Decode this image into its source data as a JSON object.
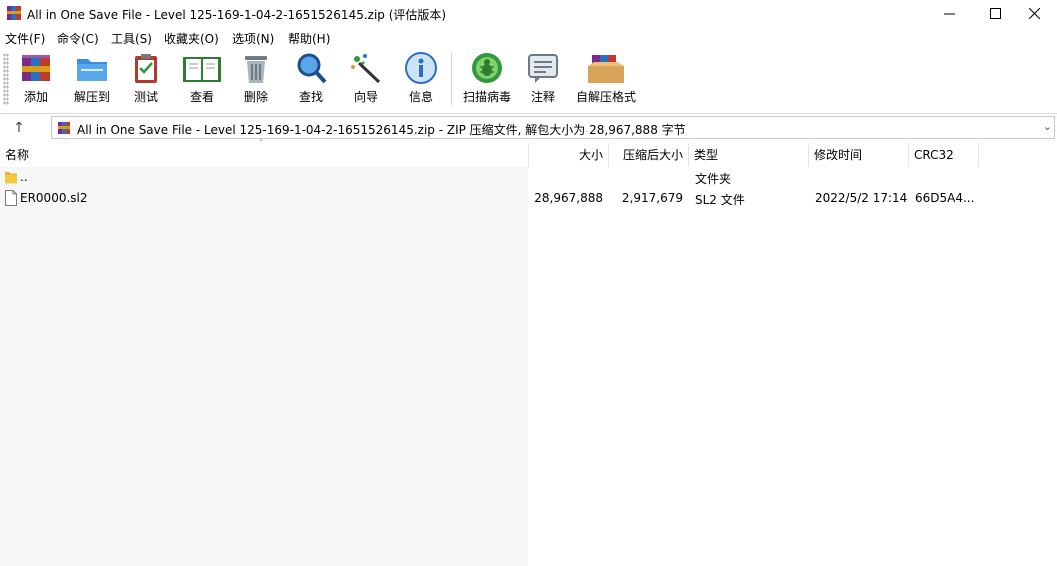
{
  "window": {
    "title": "All in One Save File - Level 125-169-1-04-2-1651526145.zip (评估版本)",
    "minimize_glyph": "—",
    "maximize_glyph": "☐",
    "close_glyph": "✕"
  },
  "menu": [
    {
      "label": "文件(F)"
    },
    {
      "label": "命令(C)"
    },
    {
      "label": "工具(S)"
    },
    {
      "label": "收藏夹(O)"
    },
    {
      "label": "选项(N)"
    },
    {
      "label": "帮助(H)"
    }
  ],
  "toolbar": [
    {
      "label": "添加",
      "icon": "add-archive-icon"
    },
    {
      "label": "解压到",
      "icon": "extract-folder-icon"
    },
    {
      "label": "测试",
      "icon": "test-clipboard-icon"
    },
    {
      "label": "查看",
      "icon": "view-book-icon"
    },
    {
      "label": "删除",
      "icon": "trash-bin-icon"
    },
    {
      "label": "查找",
      "icon": "magnifier-icon"
    },
    {
      "label": "向导",
      "icon": "wizard-wand-icon"
    },
    {
      "label": "信息",
      "icon": "info-icon"
    },
    {
      "label": "扫描病毒",
      "icon": "virus-scan-icon"
    },
    {
      "label": "注释",
      "icon": "comment-icon"
    },
    {
      "label": "自解压格式",
      "icon": "sfx-box-icon"
    }
  ],
  "address": {
    "up_glyph": "↑",
    "path": "All in One Save File - Level 125-169-1-04-2-1651526145.zip - ZIP 压缩文件, 解包大小为 28,967,888 字节"
  },
  "columns": {
    "name": "名称",
    "size": "大小",
    "packed": "压缩后大小",
    "type": "类型",
    "modified": "修改时间",
    "crc": "CRC32"
  },
  "files": [
    {
      "name": "..",
      "size": "",
      "packed": "",
      "type": "文件夹",
      "modified": "",
      "crc": "",
      "icon": "folder-icon"
    },
    {
      "name": "ER0000.sl2",
      "size": "28,967,888",
      "packed": "2,917,679",
      "type": "SL2 文件",
      "modified": "2022/5/2 17:14",
      "crc": "66D5A4...",
      "icon": "file-icon"
    }
  ],
  "colors": {
    "accent_green": "#2e9a3a",
    "folder_yellow": "#f5c842",
    "info_blue": "#2a6fc4"
  }
}
